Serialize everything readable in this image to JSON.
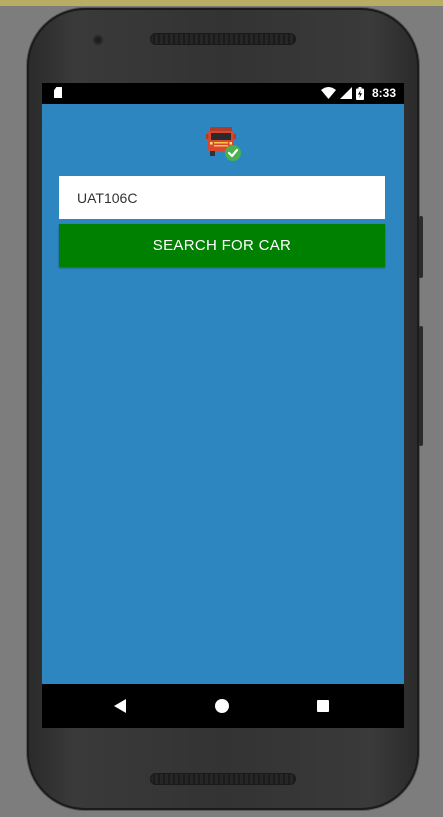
{
  "status_bar": {
    "time": "8:33",
    "icons": [
      "sd-card-icon",
      "wifi-icon",
      "signal-icon",
      "battery-charging-icon"
    ]
  },
  "app": {
    "logo_icon": "truck-check-icon",
    "plate_input": {
      "value": "UAT106C",
      "placeholder": ""
    },
    "search_button_label": "SEARCH FOR CAR"
  },
  "nav_bar": {
    "icons": [
      "back-icon",
      "home-icon",
      "recents-icon"
    ]
  },
  "colors": {
    "app_background": "#2e86c1",
    "button_background": "#008000",
    "input_background": "#ffffff",
    "device_body": "#333333"
  }
}
